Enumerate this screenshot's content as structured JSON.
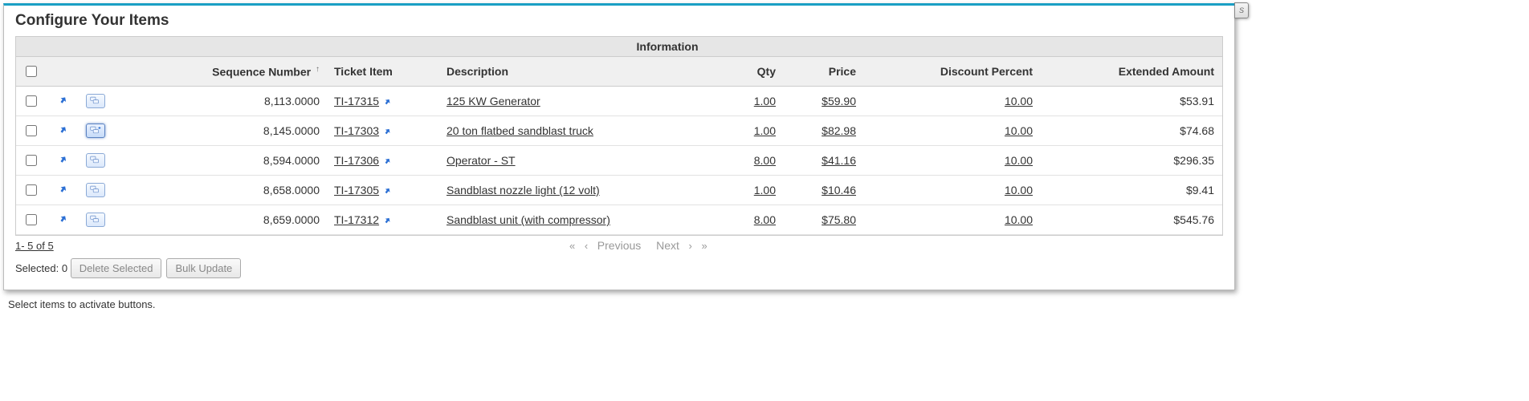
{
  "corner_label": "S",
  "title": "Configure Your Items",
  "info_header": "Information",
  "columns": {
    "sequence": "Sequence Number",
    "ticket": "Ticket Item",
    "description": "Description",
    "qty": "Qty",
    "price": "Price",
    "discount": "Discount Percent",
    "extended": "Extended Amount"
  },
  "sort_indicator": "↑",
  "rows": [
    {
      "sequence": "8,113.0000",
      "ticket": "TI-17315",
      "description": "125 KW Generator",
      "qty": "1.00",
      "price": "$59.90",
      "discount": "10.00",
      "extended": "$53.91",
      "expanded": false
    },
    {
      "sequence": "8,145.0000",
      "ticket": "TI-17303",
      "description": "20 ton flatbed sandblast truck",
      "qty": "1.00",
      "price": "$82.98",
      "discount": "10.00",
      "extended": "$74.68",
      "expanded": true
    },
    {
      "sequence": "8,594.0000",
      "ticket": "TI-17306",
      "description": "Operator - ST",
      "qty": "8.00",
      "price": "$41.16",
      "discount": "10.00",
      "extended": "$296.35",
      "expanded": false
    },
    {
      "sequence": "8,658.0000",
      "ticket": "TI-17305",
      "description": "Sandblast nozzle light (12 volt)",
      "qty": "1.00",
      "price": "$10.46",
      "discount": "10.00",
      "extended": "$9.41",
      "expanded": false
    },
    {
      "sequence": "8,659.0000",
      "ticket": "TI-17312",
      "description": "Sandblast unit (with compressor)",
      "qty": "8.00",
      "price": "$75.80",
      "discount": "10.00",
      "extended": "$545.76",
      "expanded": false
    }
  ],
  "pagination": {
    "range_label": "1- 5  of  5",
    "previous": "Previous",
    "next": "Next"
  },
  "selection": {
    "selected_label_prefix": "Selected: ",
    "selected_count": "0",
    "delete_button": "Delete Selected",
    "bulk_button": "Bulk Update"
  },
  "help_text": "Select items to activate buttons."
}
